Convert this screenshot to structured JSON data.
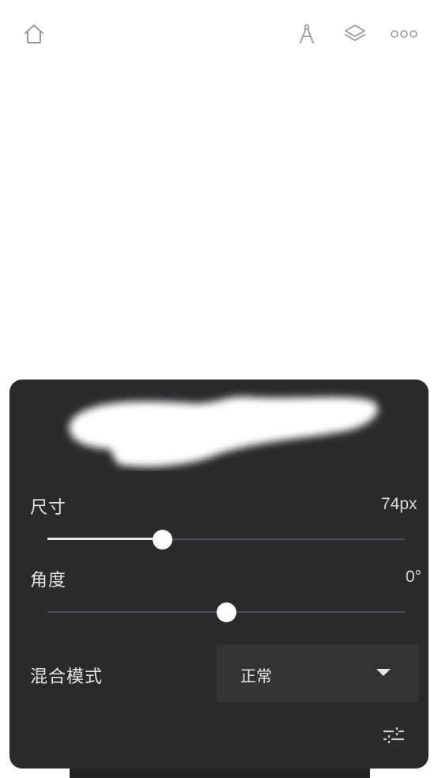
{
  "toolbar": {
    "icons": [
      "home-icon",
      "compass-icon",
      "layers-icon",
      "more-icon"
    ],
    "icon_color": "#9a9a9a"
  },
  "brush_panel": {
    "background": "#2a2a2d",
    "size": {
      "label": "尺寸",
      "value": "74px",
      "fraction": 0.32
    },
    "angle": {
      "label": "角度",
      "value": "0°",
      "fraction": 0.5
    },
    "blend_mode": {
      "label": "混合模式",
      "value": "正常"
    },
    "adjust_icon": "sliders-icon"
  }
}
